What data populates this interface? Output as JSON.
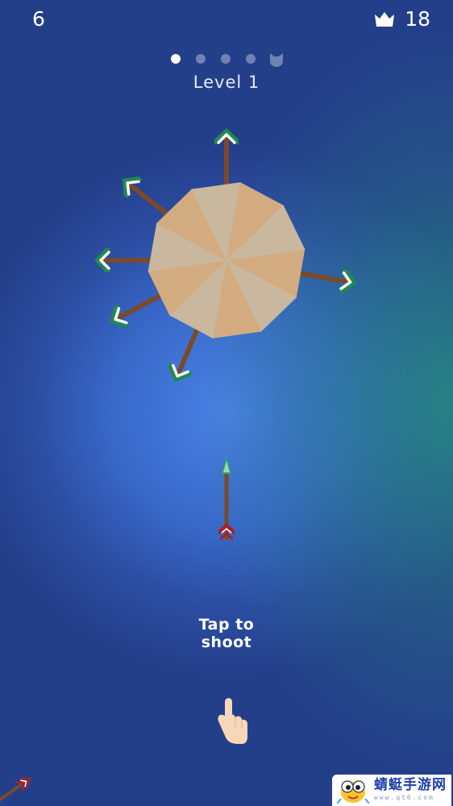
{
  "hud": {
    "score": "6",
    "best": "18",
    "best_icon": "crown-icon"
  },
  "stage": {
    "label": "Level 1",
    "total_dots": 5,
    "completed": 1,
    "boss_icon": "boss-cat-icon"
  },
  "target": {
    "colors": [
      "#d3ab80",
      "#c9b79e"
    ],
    "stuck_arrow_count": 6
  },
  "hint": {
    "line1": "Tap to",
    "line2": "shoot"
  },
  "hint_icon": "tap-hand-icon",
  "colors": {
    "arrow_shaft": "#7a4a2a",
    "fletching": "#1f8a52",
    "arrow_tip": "#2fa565",
    "nock": "#a8202a"
  },
  "watermark": {
    "name": "蜻蜓手游网",
    "url": "www.qt6.com"
  }
}
